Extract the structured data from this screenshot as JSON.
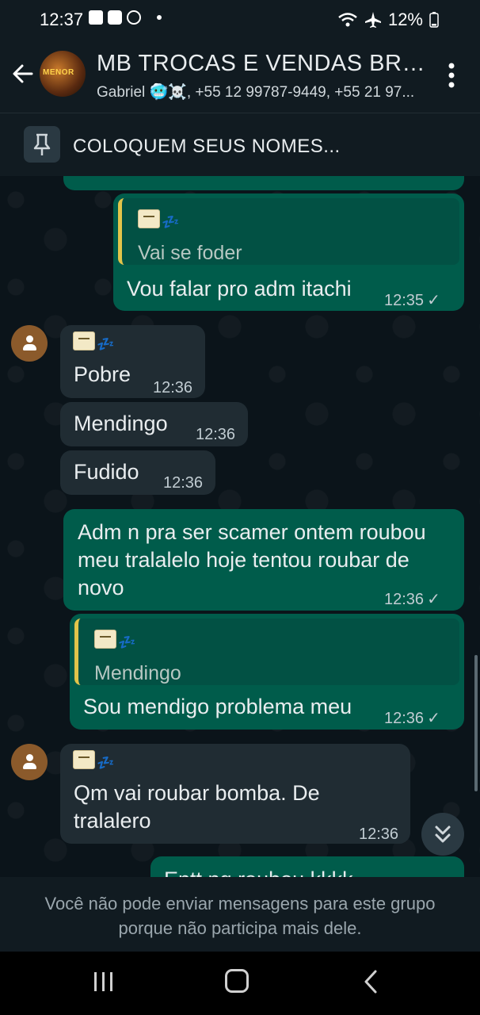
{
  "status_bar": {
    "time": "12:37",
    "battery": "12%",
    "icons": [
      "gallery-icon",
      "app-icon",
      "whatsapp-icon",
      "wifi-icon",
      "airplane-icon",
      "battery-icon"
    ]
  },
  "header": {
    "back_icon": "arrow-left-icon",
    "avatar_text": "MENOR",
    "title": "MB TROCAS E VENDAS BRAI...",
    "subtitle": "Gabriel 🥶☠️, +55 12 99787-9449, +55 21 97...",
    "menu_icon": "more-vert-icon"
  },
  "pinned": {
    "icon": "pin-icon",
    "text": "COLOQUEM SEUS NOMES..."
  },
  "messages": [
    {
      "id": "m1",
      "direction": "out",
      "quoted_sender": "💤",
      "quoted_text": "Vai se foder",
      "text": "Vou falar pro adm itachi",
      "time": "12:35",
      "status": "✓"
    },
    {
      "id": "m2",
      "direction": "in",
      "sender": "💤",
      "text": "Pobre",
      "time": "12:36"
    },
    {
      "id": "m3",
      "direction": "in",
      "text": "Mendingo",
      "time": "12:36"
    },
    {
      "id": "m4",
      "direction": "in",
      "text": "Fudido",
      "time": "12:36"
    },
    {
      "id": "m5",
      "direction": "out",
      "text": "Adm n pra ser scamer ontem roubou meu tralalelo hoje tentou roubar de novo",
      "time": "12:36",
      "status": "✓"
    },
    {
      "id": "m6",
      "direction": "out",
      "quoted_sender": "💤",
      "quoted_text": "Mendingo",
      "text": "Sou mendigo problema meu",
      "time": "12:36",
      "status": "✓"
    },
    {
      "id": "m7",
      "direction": "in",
      "sender": "💤",
      "text": "Qm vai roubar bomba. De tralalero",
      "time": "12:36"
    },
    {
      "id": "m8",
      "direction": "out",
      "text": "Entt ng roubou kkkk",
      "partial": true
    }
  ],
  "scroll_button_icon": "chevron-double-down-icon",
  "footer": {
    "text": "Você não pode enviar mensagens para este grupo porque não participa mais dele."
  },
  "nav": {
    "recent_icon": "recent-apps-icon",
    "home_icon": "home-icon",
    "back_icon": "back-chevron-icon"
  },
  "colors": {
    "background": "#0b141a",
    "bar": "#111b21",
    "outgoing_bubble": "#005c4b",
    "incoming_bubble": "#202c33",
    "quote_bar": "#e2c44a"
  }
}
